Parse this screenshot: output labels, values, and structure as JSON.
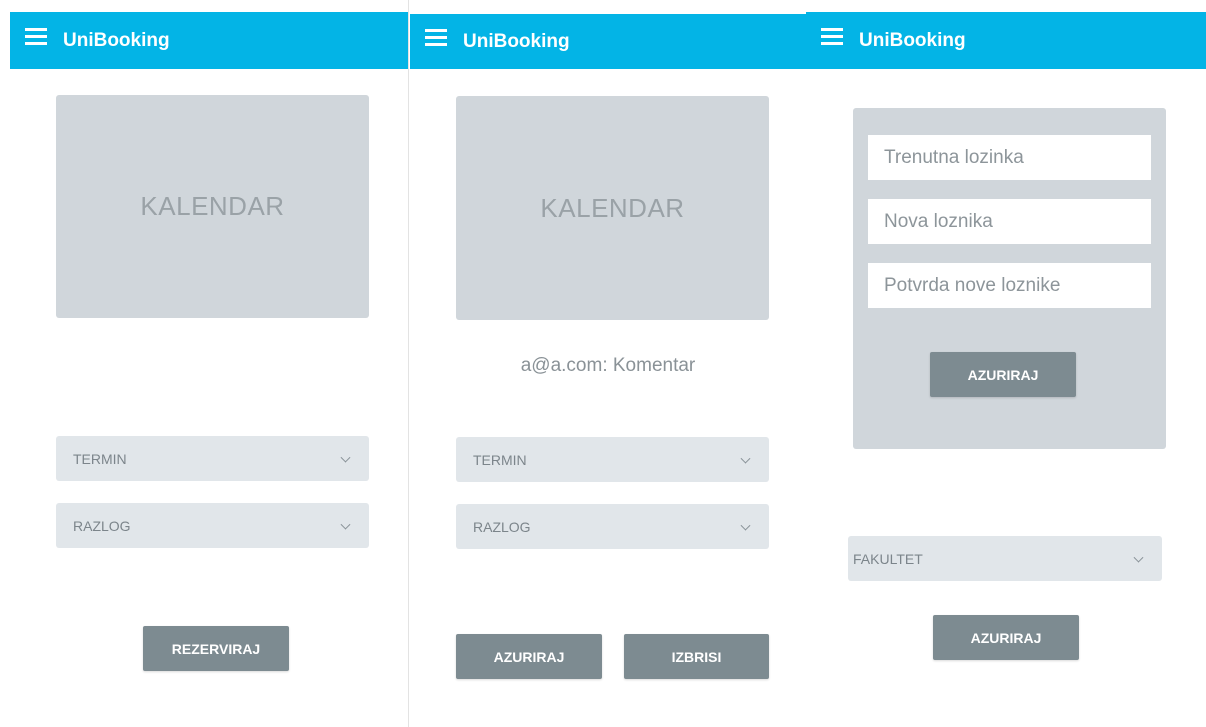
{
  "screens": [
    {
      "app_title": "UniBooking",
      "calendar_label": "KALENDAR",
      "selects": [
        {
          "label": "TERMIN"
        },
        {
          "label": "RAZLOG"
        }
      ],
      "buttons": [
        {
          "label": "REZERVIRAJ"
        }
      ]
    },
    {
      "app_title": "UniBooking",
      "calendar_label": "KALENDAR",
      "comment": "a@a.com: Komentar",
      "selects": [
        {
          "label": "TERMIN"
        },
        {
          "label": "RAZLOG"
        }
      ],
      "buttons": [
        {
          "label": "AZURIRAJ"
        },
        {
          "label": "IZBRISI"
        }
      ]
    },
    {
      "app_title": "UniBooking",
      "password_form": {
        "current_placeholder": "Trenutna lozinka",
        "new_placeholder": "Nova loznika",
        "confirm_placeholder": "Potvrda nove loznike",
        "submit_label": "AZURIRAJ"
      },
      "selects": [
        {
          "label": "FAKULTET"
        }
      ],
      "buttons": [
        {
          "label": "AZURIRAJ"
        }
      ]
    }
  ],
  "colors": {
    "app_bar": "#03b4e6",
    "placeholder_block": "#d0d6db",
    "select_bg": "#e1e6ea",
    "button_bg": "#7d8b91"
  },
  "icons": {
    "menu": "hamburger-menu-icon",
    "dropdown": "chevron-down-icon"
  }
}
